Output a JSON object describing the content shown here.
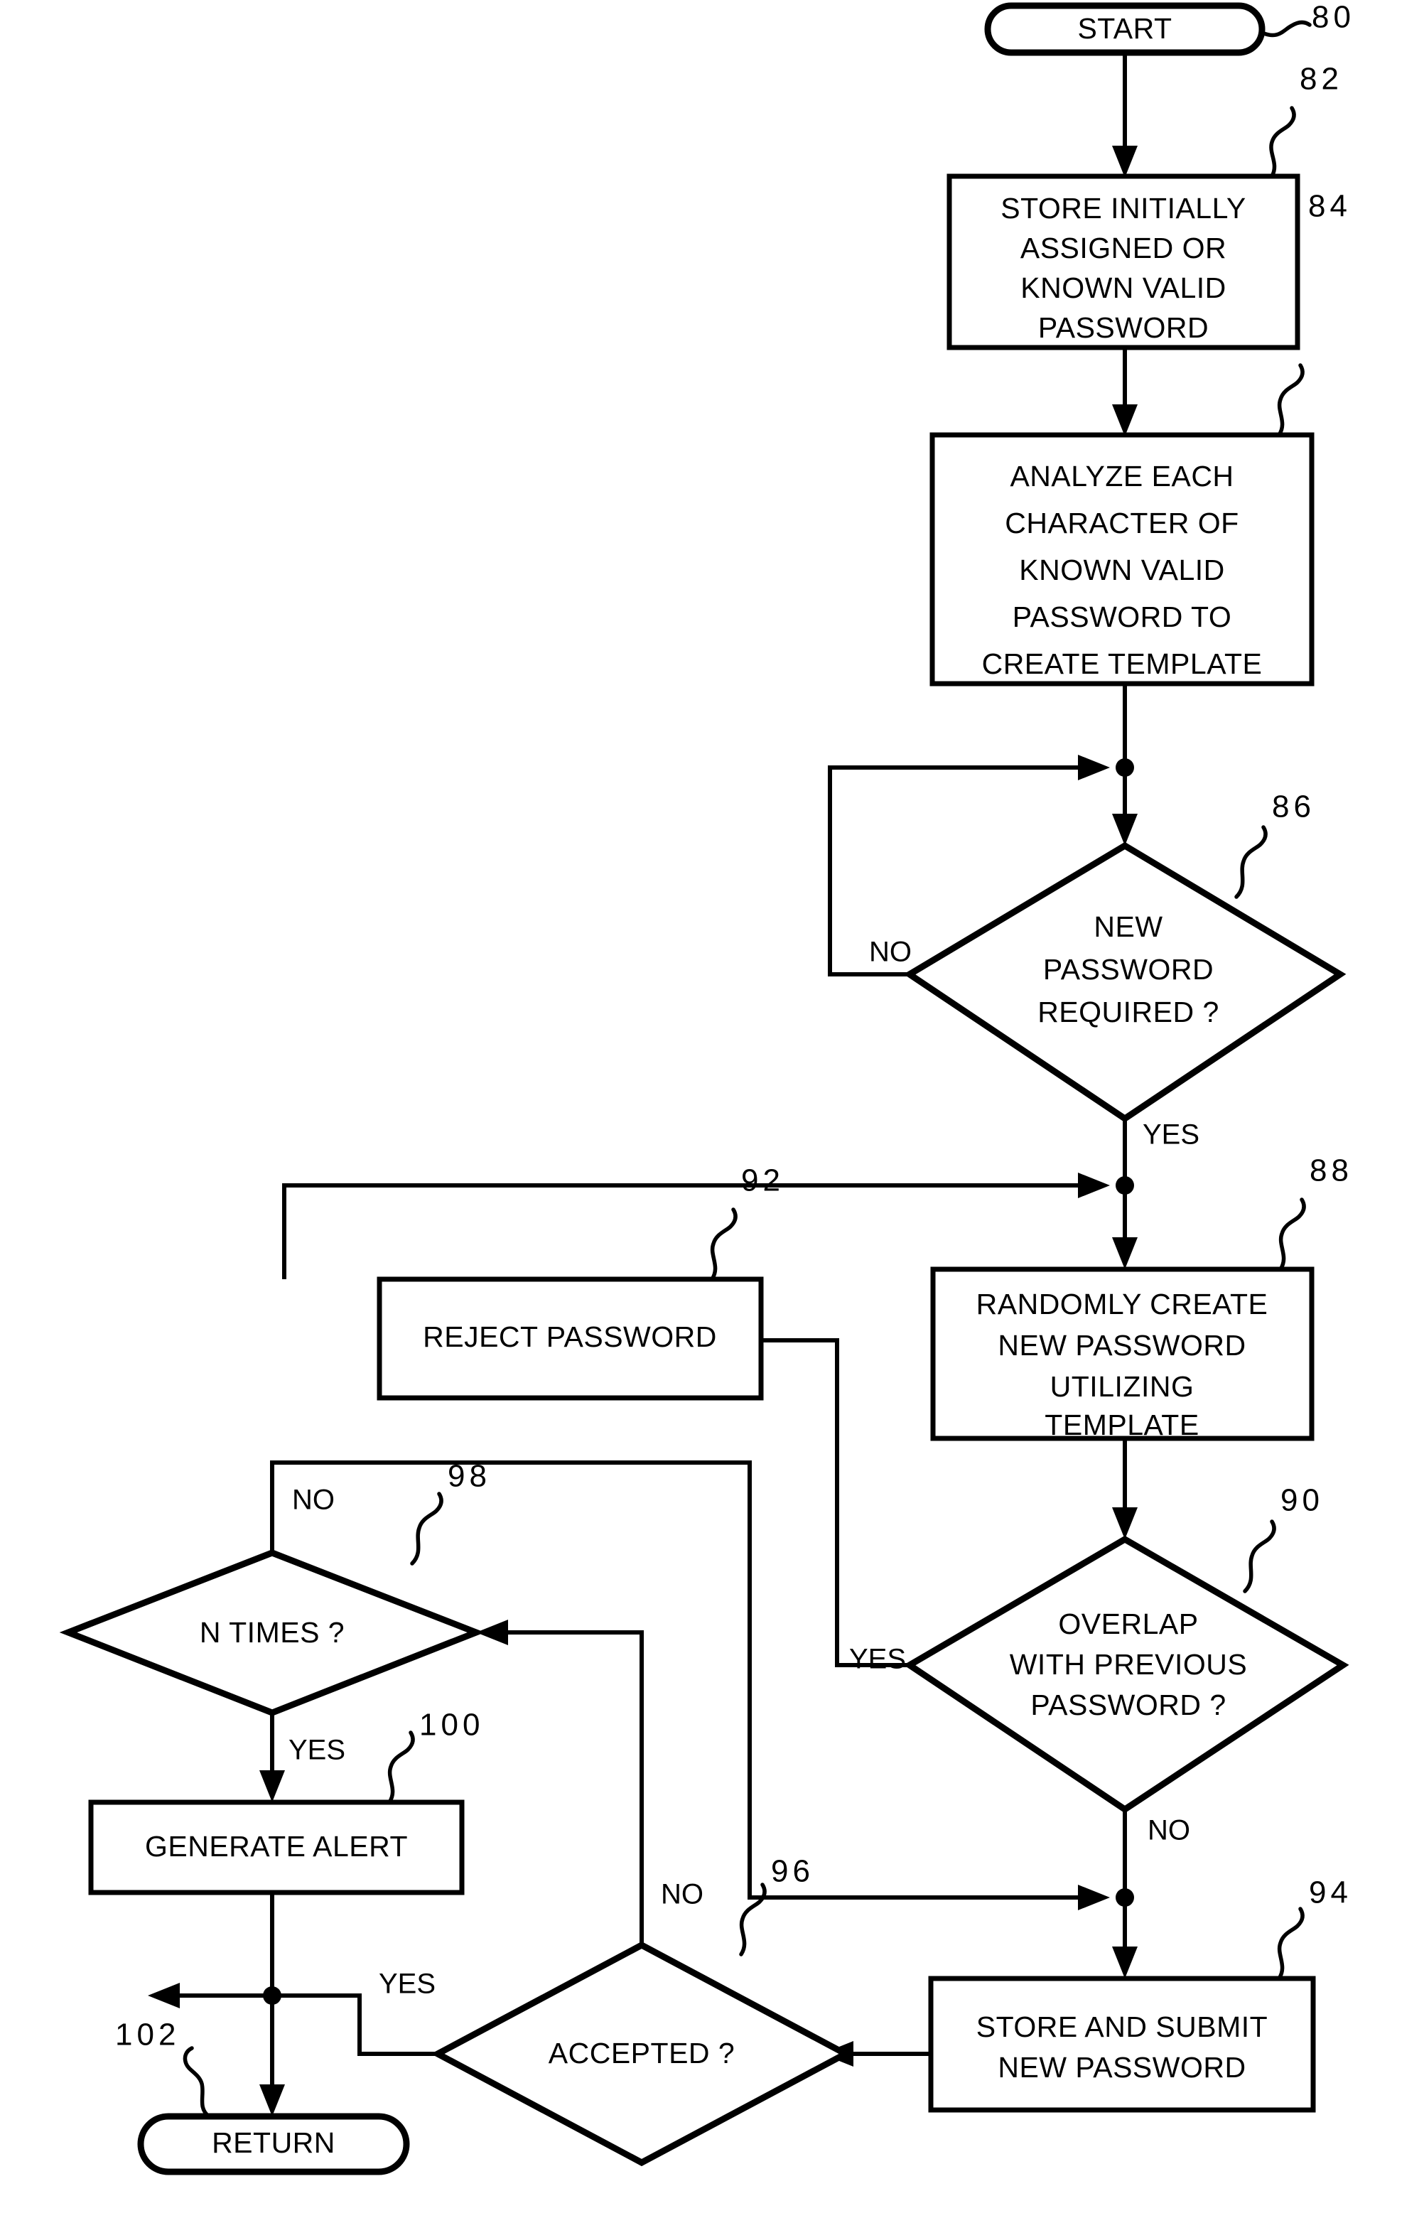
{
  "figure": {
    "type": "flowchart",
    "title": "",
    "background_color": "#ffffff",
    "line_color": "#000000"
  },
  "nodes": {
    "start": {
      "ref": "80",
      "shape": "terminator",
      "lines": [
        "START"
      ]
    },
    "store_initial": {
      "ref": "82",
      "shape": "process",
      "lines": [
        "STORE INITIALLY",
        "ASSIGNED OR",
        "KNOWN VALID",
        "PASSWORD"
      ]
    },
    "analyze": {
      "ref": "84",
      "shape": "process",
      "lines": [
        "ANALYZE EACH",
        "CHARACTER OF",
        "KNOWN VALID",
        "PASSWORD TO",
        "CREATE TEMPLATE"
      ]
    },
    "new_password_required": {
      "ref": "86",
      "shape": "decision",
      "lines": [
        "NEW",
        "PASSWORD",
        "REQUIRED ?"
      ]
    },
    "randomly_create": {
      "ref": "88",
      "shape": "process",
      "lines": [
        "RANDOMLY CREATE",
        "NEW PASSWORD",
        "UTILIZING",
        "TEMPLATE"
      ]
    },
    "overlap": {
      "ref": "90",
      "shape": "decision",
      "lines": [
        "OVERLAP",
        "WITH PREVIOUS",
        "PASSWORD ?"
      ]
    },
    "reject_password": {
      "ref": "92",
      "shape": "process",
      "lines": [
        "REJECT PASSWORD"
      ]
    },
    "store_submit": {
      "ref": "94",
      "shape": "process",
      "lines": [
        "STORE AND SUBMIT",
        "NEW PASSWORD"
      ]
    },
    "accepted": {
      "ref": "96",
      "shape": "decision",
      "lines": [
        "ACCEPTED ?"
      ]
    },
    "n_times": {
      "ref": "98",
      "shape": "decision",
      "lines": [
        "N TIMES ?"
      ]
    },
    "generate_alert": {
      "ref": "100",
      "shape": "process",
      "lines": [
        "GENERATE ALERT"
      ]
    },
    "return": {
      "ref": "102",
      "shape": "terminator",
      "lines": [
        "RETURN"
      ]
    }
  },
  "edge_labels": {
    "required_no": "NO",
    "required_yes": "YES",
    "overlap_yes": "YES",
    "overlap_no": "NO",
    "accepted_no": "NO",
    "accepted_yes": "YES",
    "ntimes_no": "NO",
    "ntimes_yes": "YES"
  },
  "reference_numerals": {
    "start": "80",
    "store_initial": "82",
    "analyze": "84",
    "new_password_required": "86",
    "randomly_create": "88",
    "overlap": "90",
    "reject_password": "92",
    "store_submit": "94",
    "accepted": "96",
    "n_times": "98",
    "generate_alert": "100",
    "return": "102"
  }
}
